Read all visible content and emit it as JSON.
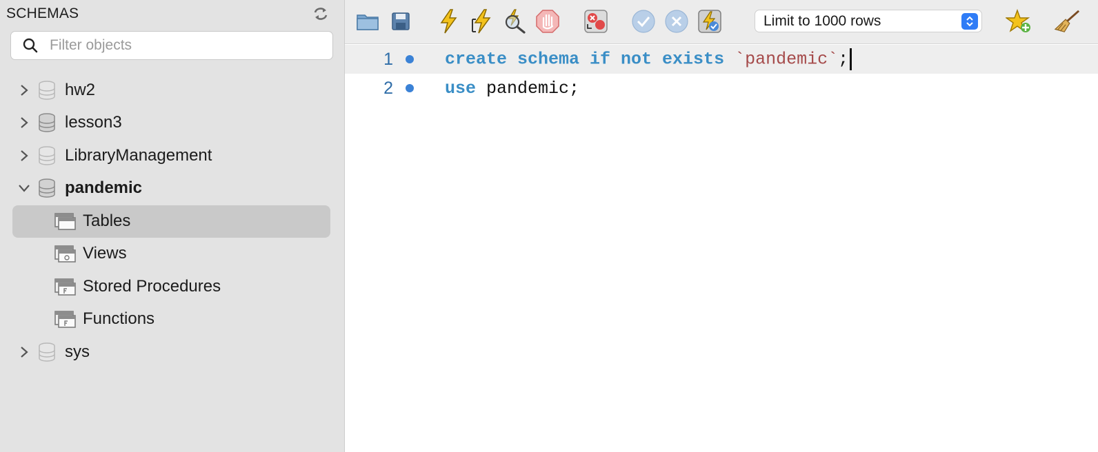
{
  "sidebar": {
    "title": "SCHEMAS",
    "filter_placeholder": "Filter objects",
    "schemas": [
      {
        "label": "hw2",
        "expanded": false
      },
      {
        "label": "lesson3",
        "expanded": false
      },
      {
        "label": "LibraryManagement",
        "expanded": false
      },
      {
        "label": "pandemic",
        "expanded": true
      },
      {
        "label": "sys",
        "expanded": false
      }
    ],
    "pandemic_children": [
      {
        "label": "Tables",
        "selected": true
      },
      {
        "label": "Views",
        "selected": false
      },
      {
        "label": "Stored Procedures",
        "selected": false
      },
      {
        "label": "Functions",
        "selected": false
      }
    ]
  },
  "toolbar": {
    "buttons": [
      "open-file-icon",
      "save-icon",
      "execute-icon",
      "execute-current-icon",
      "explain-icon",
      "stop-icon",
      "toggle-error-stop-icon",
      "commit-icon",
      "rollback-icon",
      "autocommit-icon",
      "add-snippet-icon",
      "beautify-icon"
    ],
    "limit_select_value": "Limit to 1000 rows"
  },
  "editor": {
    "lines": [
      {
        "number": "1",
        "tokens": [
          {
            "text": "create schema if not exists",
            "kind": "kw"
          },
          {
            "text": " ",
            "kind": "plain"
          },
          {
            "text": "`pandemic`",
            "kind": "str"
          },
          {
            "text": ";",
            "kind": "plain"
          }
        ]
      },
      {
        "number": "2",
        "tokens": [
          {
            "text": "use",
            "kind": "kw"
          },
          {
            "text": " pandemic;",
            "kind": "plain"
          }
        ]
      }
    ]
  },
  "colors": {
    "keyword": "#3a8ec6",
    "string": "#a54a4a",
    "line_number": "#2f6da8",
    "marker": "#3b82d6",
    "accent": "#2f7cf6"
  }
}
